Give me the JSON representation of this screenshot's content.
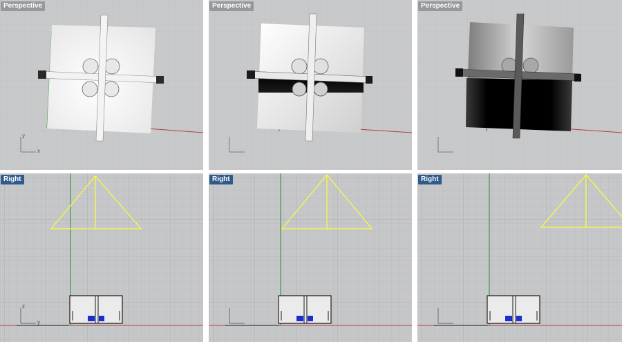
{
  "viewports": [
    {
      "name": "Perspective",
      "kind": "perspective",
      "variant": 1
    },
    {
      "name": "Perspective",
      "kind": "perspective",
      "variant": 2
    },
    {
      "name": "Perspective",
      "kind": "perspective",
      "variant": 3
    },
    {
      "name": "Right",
      "kind": "right",
      "variant": 1
    },
    {
      "name": "Right",
      "kind": "right",
      "variant": 2
    },
    {
      "name": "Right",
      "kind": "right",
      "variant": 3
    }
  ],
  "axis_labels": {
    "x": "x",
    "y": "y",
    "z": "z"
  },
  "colors": {
    "grid_minor": "#bdbec0",
    "grid_major": "#a9aaac",
    "x_axis": "#b0413e",
    "y_axis": "#3b9b3b",
    "light_wireframe": "#ffff33",
    "object_outline": "#1a1a1a",
    "blue_parts": "#1a2fd1"
  }
}
